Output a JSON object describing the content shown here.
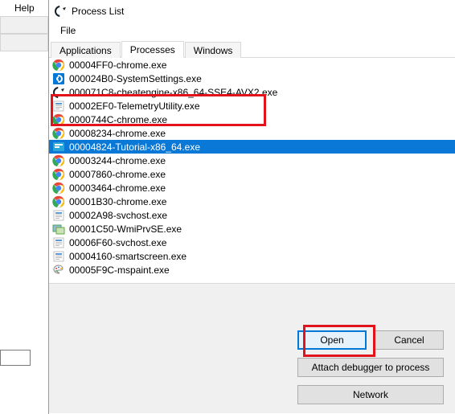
{
  "parent": {
    "help_menu": "Help"
  },
  "dialog": {
    "title": "Process List",
    "menu": {
      "file": "File"
    },
    "tabs": {
      "applications": "Applications",
      "processes": "Processes",
      "windows": "Windows"
    },
    "buttons": {
      "open": "Open",
      "cancel": "Cancel",
      "attach": "Attach debugger to process",
      "network": "Network"
    }
  },
  "processes": [
    {
      "icon": "chrome",
      "name": "00004FF0-chrome.exe",
      "selected": false
    },
    {
      "icon": "settings",
      "name": "000024B0-SystemSettings.exe",
      "selected": false
    },
    {
      "icon": "cheatengine",
      "name": "000071C8-cheatengine-x86_64-SSE4-AVX2.exe",
      "selected": false
    },
    {
      "icon": "generic",
      "name": "00002EF0-TelemetryUtility.exe",
      "selected": false
    },
    {
      "icon": "chrome",
      "name": "0000744C-chrome.exe",
      "selected": false
    },
    {
      "icon": "chrome",
      "name": "00008234-chrome.exe",
      "selected": false
    },
    {
      "icon": "tutorial",
      "name": "00004824-Tutorial-x86_64.exe",
      "selected": true
    },
    {
      "icon": "chrome",
      "name": "00003244-chrome.exe",
      "selected": false
    },
    {
      "icon": "chrome",
      "name": "00007860-chrome.exe",
      "selected": false
    },
    {
      "icon": "chrome",
      "name": "00003464-chrome.exe",
      "selected": false
    },
    {
      "icon": "chrome",
      "name": "00001B30-chrome.exe",
      "selected": false
    },
    {
      "icon": "generic",
      "name": "00002A98-svchost.exe",
      "selected": false
    },
    {
      "icon": "wmi",
      "name": "00001C50-WmiPrvSE.exe",
      "selected": false
    },
    {
      "icon": "generic",
      "name": "00006F60-svchost.exe",
      "selected": false
    },
    {
      "icon": "generic",
      "name": "00004160-smartscreen.exe",
      "selected": false
    },
    {
      "icon": "mspaint",
      "name": "00005F9C-mspaint.exe",
      "selected": false
    }
  ]
}
